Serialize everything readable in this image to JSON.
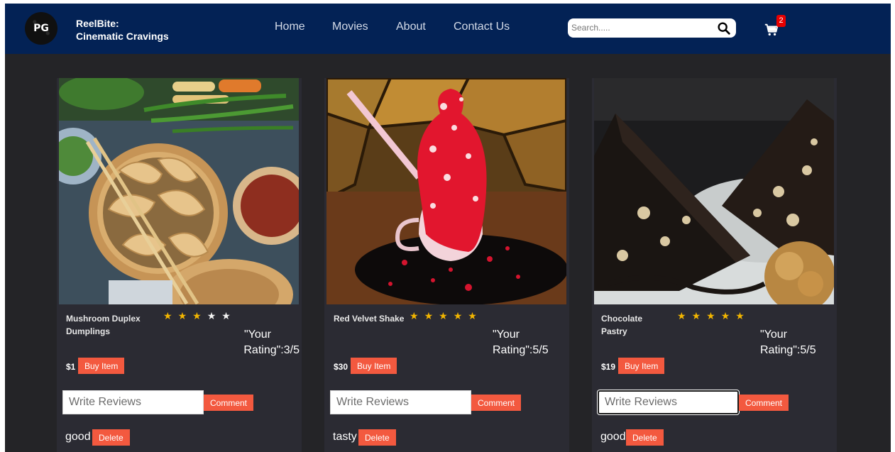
{
  "header": {
    "logo_text": "PG",
    "brand_line1": "ReelBite:",
    "brand_line2": "Cinematic Cravings",
    "nav": [
      "Home",
      "Movies",
      "About",
      "Contact Us"
    ],
    "search_placeholder": "Search.....",
    "cart_count": "2",
    "colors": {
      "navbar": "#032255",
      "badge": "#e80000"
    }
  },
  "colors": {
    "background": "#242427",
    "card": "#2b2b33",
    "button": "#f3593f",
    "star": "#f3b600"
  },
  "cards": [
    {
      "name": "Mushroom Duplex Dumplings",
      "stars_filled": 3,
      "stars_total": 5,
      "rating_line1": "\"Your",
      "rating_line2": "Rating\":3/5",
      "price": "$1",
      "buy_label": "Buy Item",
      "review_placeholder": "Write Reviews",
      "comment_label": "Comment",
      "review": "good",
      "delete_label": "Delete",
      "image": "dumplings-photo"
    },
    {
      "name": "Red Velvet Shake",
      "stars_filled": 5,
      "stars_total": 5,
      "rating_line1": "\"Your",
      "rating_line2": "Rating\":5/5",
      "price": "$30",
      "buy_label": "Buy Item",
      "review_placeholder": "Write Reviews",
      "comment_label": "Comment",
      "review": "tasty",
      "delete_label": "Delete",
      "image": "shake-photo"
    },
    {
      "name": "Chocolate Pastry",
      "stars_filled": 5,
      "stars_total": 5,
      "rating_line1": "\"Your",
      "rating_line2": "Rating\":5/5",
      "price": "$19",
      "buy_label": "Buy Item",
      "review_placeholder": "Write Reviews",
      "comment_label": "Comment",
      "review": "good",
      "delete_label": "Delete",
      "image": "pastry-photo"
    }
  ]
}
